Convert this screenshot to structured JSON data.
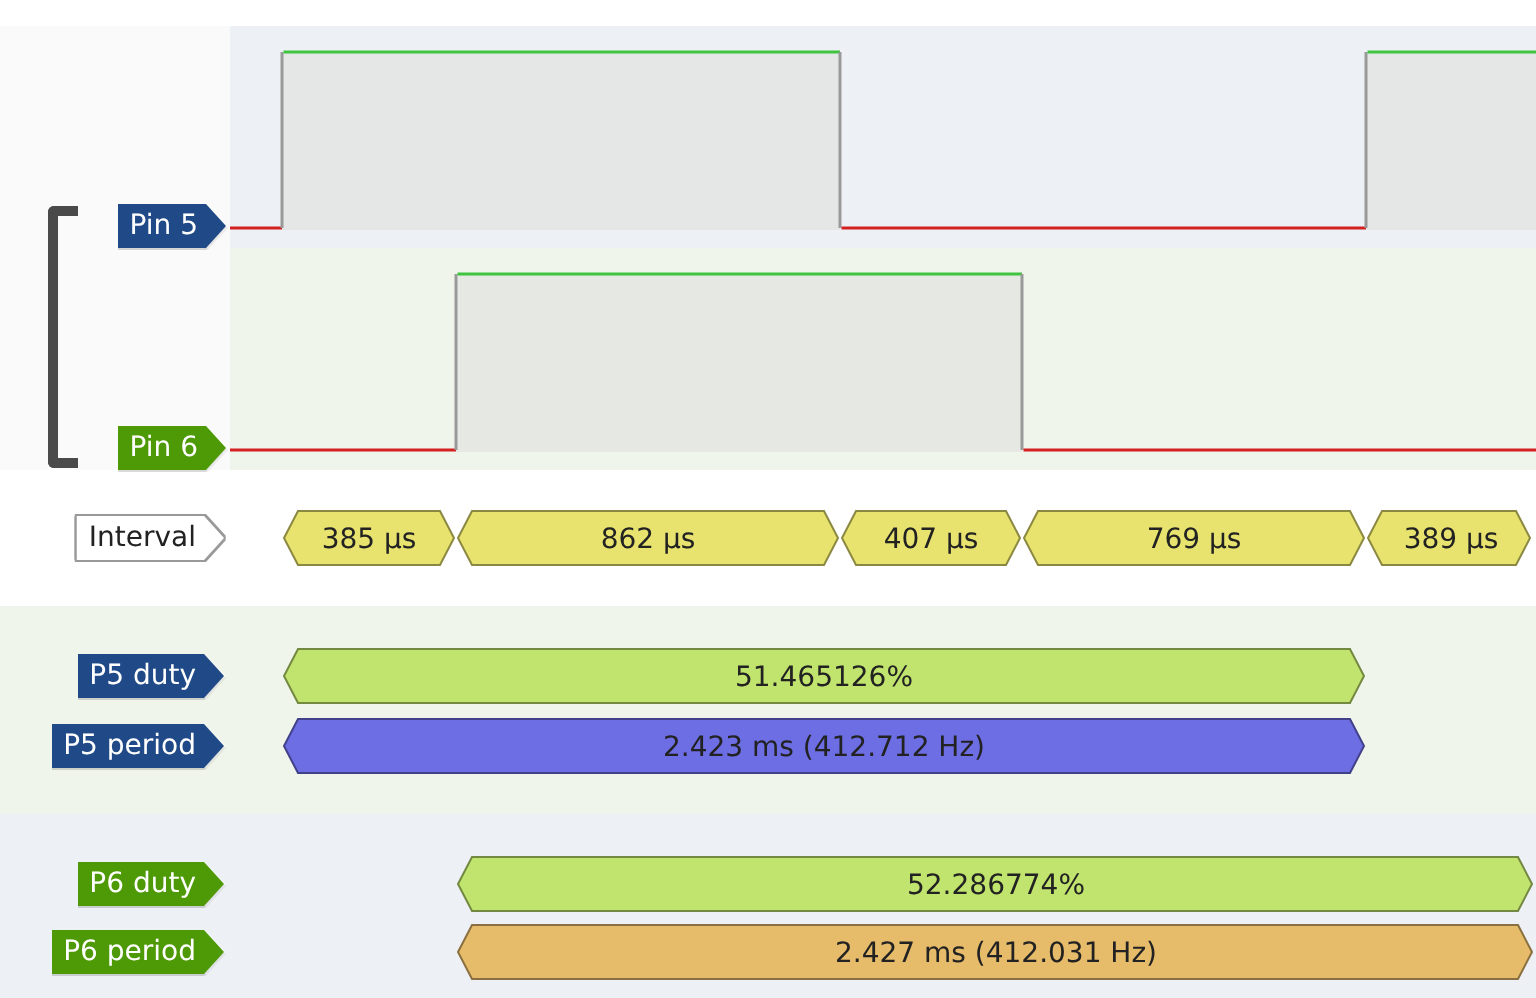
{
  "pins": [
    {
      "label": "Pin 5",
      "color": "#204a87",
      "high": [
        false,
        true,
        true,
        false,
        false,
        true
      ]
    },
    {
      "label": "Pin 6",
      "color": "#4e9a06",
      "high": [
        false,
        false,
        true,
        true,
        false,
        false
      ]
    }
  ],
  "interval": {
    "label": "Interval",
    "color": "#e8e36e",
    "values": [
      "385 µs",
      "862 µs",
      "407 µs",
      "769 µs",
      "389 µs"
    ]
  },
  "decoders": [
    {
      "rows": [
        {
          "label": {
            "text": "P5 duty",
            "color": "#204a87"
          },
          "annotation": {
            "text": "51.465126%",
            "color": "#c0e46d"
          }
        },
        {
          "label": {
            "text": "P5 period",
            "color": "#204a87"
          },
          "annotation": {
            "text": "2.423 ms (412.712 Hz)",
            "color": "#6d6de4"
          }
        }
      ]
    },
    {
      "rows": [
        {
          "label": {
            "text": "P6 duty",
            "color": "#4e9a06"
          },
          "annotation": {
            "text": "52.286774%",
            "color": "#c0e46d"
          }
        },
        {
          "label": {
            "text": "P6 period",
            "color": "#4e9a06"
          },
          "annotation": {
            "text": "2.427 ms (412.031 Hz)",
            "color": "#e6bb6a"
          }
        }
      ]
    }
  ]
}
